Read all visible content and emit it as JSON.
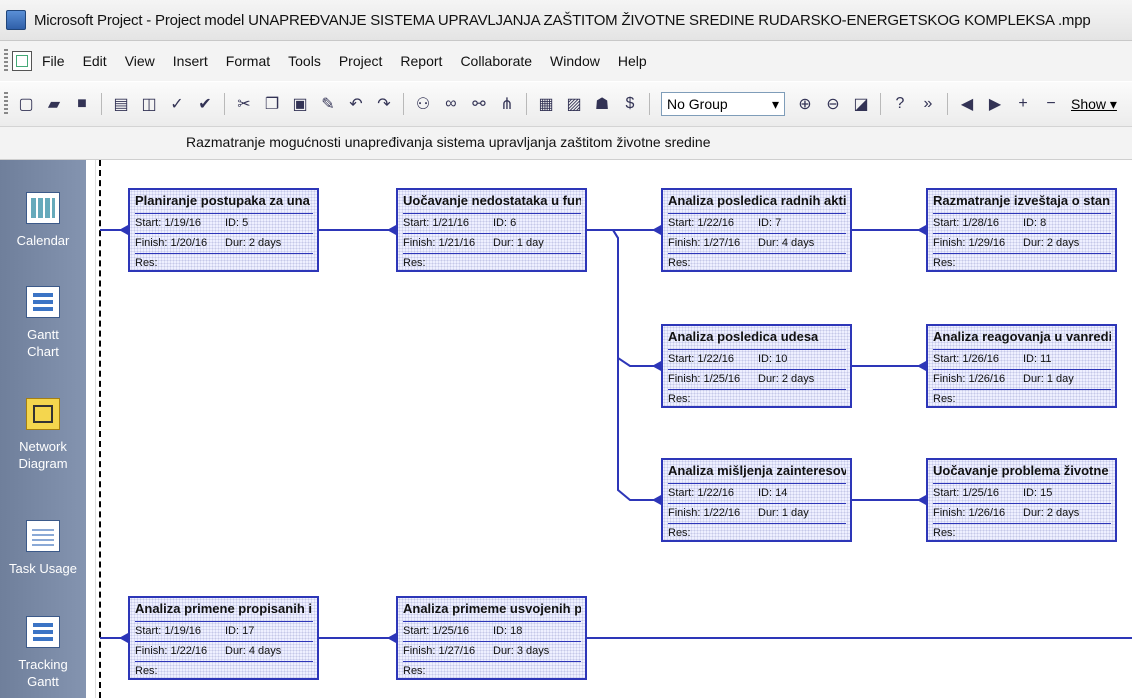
{
  "window": {
    "title": "Microsoft Project - Project model UNAPREĐVANJE SISTEMA UPRAVLJANJA ZAŠTITOM ŽIVOTNE SREDINE RUDARSKO-ENERGETSKOG KOMPLEKSA .mpp"
  },
  "menu": [
    "File",
    "Edit",
    "View",
    "Insert",
    "Format",
    "Tools",
    "Project",
    "Report",
    "Collaborate",
    "Window",
    "Help"
  ],
  "toolbar": {
    "group_value": "No Group",
    "show_label": "Show ▾"
  },
  "entry_bar": {
    "text": "Razmatranje mogućnosti unapređivanja sistema upravljanja zaštitom životne sredine"
  },
  "view_bar": [
    {
      "label": "Calendar"
    },
    {
      "label": "Gantt Chart"
    },
    {
      "label": "Network Diagram"
    },
    {
      "label": "Task Usage"
    },
    {
      "label": "Tracking Gantt"
    }
  ],
  "nodes": [
    {
      "title": "Planiranje postupaka za una",
      "start": "Start: 1/19/16",
      "id": "ID: 5",
      "finish": "Finish: 1/20/16",
      "dur": "Dur: 2 days",
      "res": "Res:"
    },
    {
      "title": "Uočavanje nedostataka u fun",
      "start": "Start: 1/21/16",
      "id": "ID: 6",
      "finish": "Finish: 1/21/16",
      "dur": "Dur: 1 day",
      "res": "Res:"
    },
    {
      "title": "Analiza posledica radnih akti",
      "start": "Start: 1/22/16",
      "id": "ID: 7",
      "finish": "Finish: 1/27/16",
      "dur": "Dur: 4 days",
      "res": "Res:"
    },
    {
      "title": "Razmatranje izveštaja o stan",
      "start": "Start: 1/28/16",
      "id": "ID: 8",
      "finish": "Finish: 1/29/16",
      "dur": "Dur: 2 days",
      "res": "Res:"
    },
    {
      "title": "Analiza posledica udesa",
      "start": "Start: 1/22/16",
      "id": "ID: 10",
      "finish": "Finish: 1/25/16",
      "dur": "Dur: 2 days",
      "res": "Res:"
    },
    {
      "title": "Analiza reagovanja u vanredi",
      "start": "Start: 1/26/16",
      "id": "ID: 11",
      "finish": "Finish: 1/26/16",
      "dur": "Dur: 1 day",
      "res": "Res:"
    },
    {
      "title": "Analiza mišljenja zainteresov",
      "start": "Start: 1/22/16",
      "id": "ID: 14",
      "finish": "Finish: 1/22/16",
      "dur": "Dur: 1 day",
      "res": "Res:"
    },
    {
      "title": "Uočavanje problema životne",
      "start": "Start: 1/25/16",
      "id": "ID: 15",
      "finish": "Finish: 1/26/16",
      "dur": "Dur: 2 days",
      "res": "Res:"
    },
    {
      "title": "Analiza primene propisanih i",
      "start": "Start: 1/19/16",
      "id": "ID: 17",
      "finish": "Finish: 1/22/16",
      "dur": "Dur: 4 days",
      "res": "Res:"
    },
    {
      "title": "Analiza primeme usvojenih p",
      "start": "Start: 1/25/16",
      "id": "ID: 18",
      "finish": "Finish: 1/27/16",
      "dur": "Dur: 3 days",
      "res": "Res:"
    }
  ]
}
